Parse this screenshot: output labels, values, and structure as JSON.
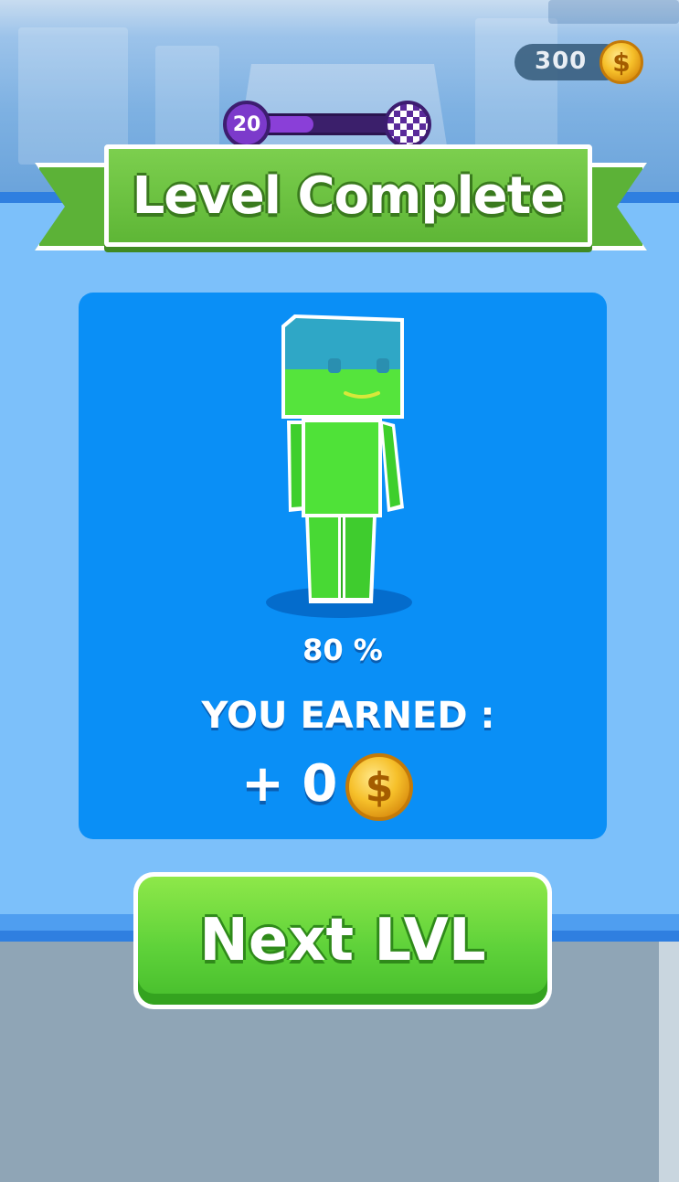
{
  "hud": {
    "coin_count": "300",
    "coin_icon": "dollar-coin-icon",
    "level_number": "20",
    "level_progress": 0.4
  },
  "banner": {
    "title": "Level Complete"
  },
  "result": {
    "percent": "80 %",
    "earned_label": "YOU EARNED :",
    "earned_amount": "+ 0",
    "coin_symbol": "$"
  },
  "buttons": {
    "next_label": "Next LVL"
  },
  "colors": {
    "panel": "#7cc0fa",
    "card": "#0a8ff6",
    "ribbon_green": "#5eb636",
    "button_green": "#5fd23a",
    "character_green": "#4ee43a",
    "character_head_top": "#2aa8c8"
  }
}
